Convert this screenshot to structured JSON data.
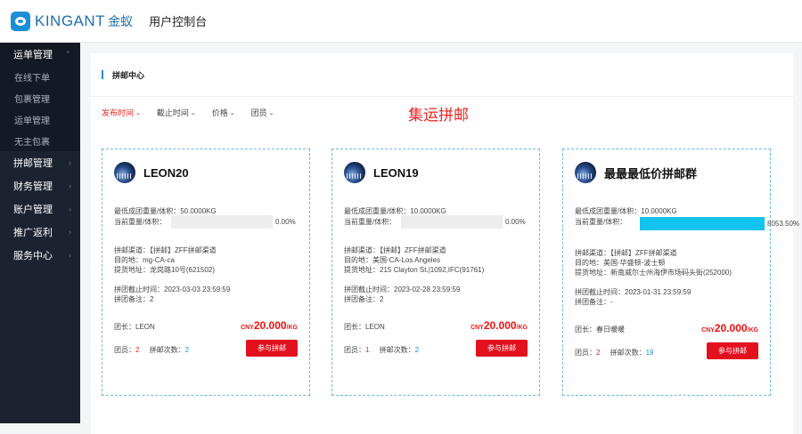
{
  "header": {
    "logo_text": "KINGANT",
    "logo_cn": "金蚁",
    "app_title": "用户控制台"
  },
  "sidebar": {
    "open_group": "运单管理",
    "sub_items": [
      "在线下单",
      "包裹管理",
      "运单管理",
      "无主包裹"
    ],
    "groups": [
      "拼邮管理",
      "财务管理",
      "账户管理",
      "推广返利",
      "服务中心"
    ]
  },
  "panel": {
    "title": "拼邮中心",
    "banner": "集运拼邮"
  },
  "filters": [
    {
      "label": "发布时间",
      "active": true
    },
    {
      "label": "截止时间",
      "active": false
    },
    {
      "label": "价格",
      "active": false
    },
    {
      "label": "团员",
      "active": false
    }
  ],
  "labels": {
    "min_weight": "最低成团重量/体积：",
    "current_weight": "当前重量/体积：",
    "channel": "拼邮渠道：",
    "destination": "目的地：",
    "pickup": "提货地址：",
    "deadline": "拼团截止时间：",
    "note": "拼团备注：",
    "leader": "团长：",
    "members": "团员：",
    "times": "拼邮次数：",
    "join": "参与拼邮",
    "currency": "CNY",
    "unit": "/KG"
  },
  "cards": [
    {
      "name": "LEON20",
      "min_weight": "50.0000KG",
      "progress_pct": 0,
      "progress_text": "0.00%",
      "channel": "【拼邮】ZFF拼邮渠道",
      "destination": "mg-CA-ca",
      "pickup": "龙岗路10号(621502)",
      "deadline": "2023-03-03 23:59:59",
      "note": "2",
      "leader": "LEON",
      "price": "20.000",
      "members": "2",
      "times": "2"
    },
    {
      "name": "LEON19",
      "min_weight": "10.0000KG",
      "progress_pct": 0,
      "progress_text": "0.00%",
      "channel": "【拼邮】ZFF拼邮渠道",
      "destination": "美国-CA-Los Angeles",
      "pickup": "215 Clayton St.|1092,IFC(91761)",
      "deadline": "2023-02-28 23:59:59",
      "note": "2",
      "leader": "LEON",
      "price": "20.000",
      "members": "1",
      "times": "2"
    },
    {
      "name": "最最最低价拼邮群",
      "min_weight": "10.0000KG",
      "progress_pct": 100,
      "progress_text": "8053.50%",
      "channel": "【拼邮】ZFF拼邮渠道",
      "destination": "美国-华盛顿-波士顿",
      "pickup": "新南威尔士州海伊市场码头街(252000)",
      "deadline": "2023-01-31 23:59:59",
      "note": "-",
      "leader": "春日暖暖",
      "price": "20.000",
      "members": "2",
      "times": "19"
    }
  ],
  "colors": {
    "accent_blue": "#1a8fd6",
    "red": "#e3111d",
    "sidebar_bg": "#1b2331",
    "progress_fill": "#12c3ef"
  }
}
